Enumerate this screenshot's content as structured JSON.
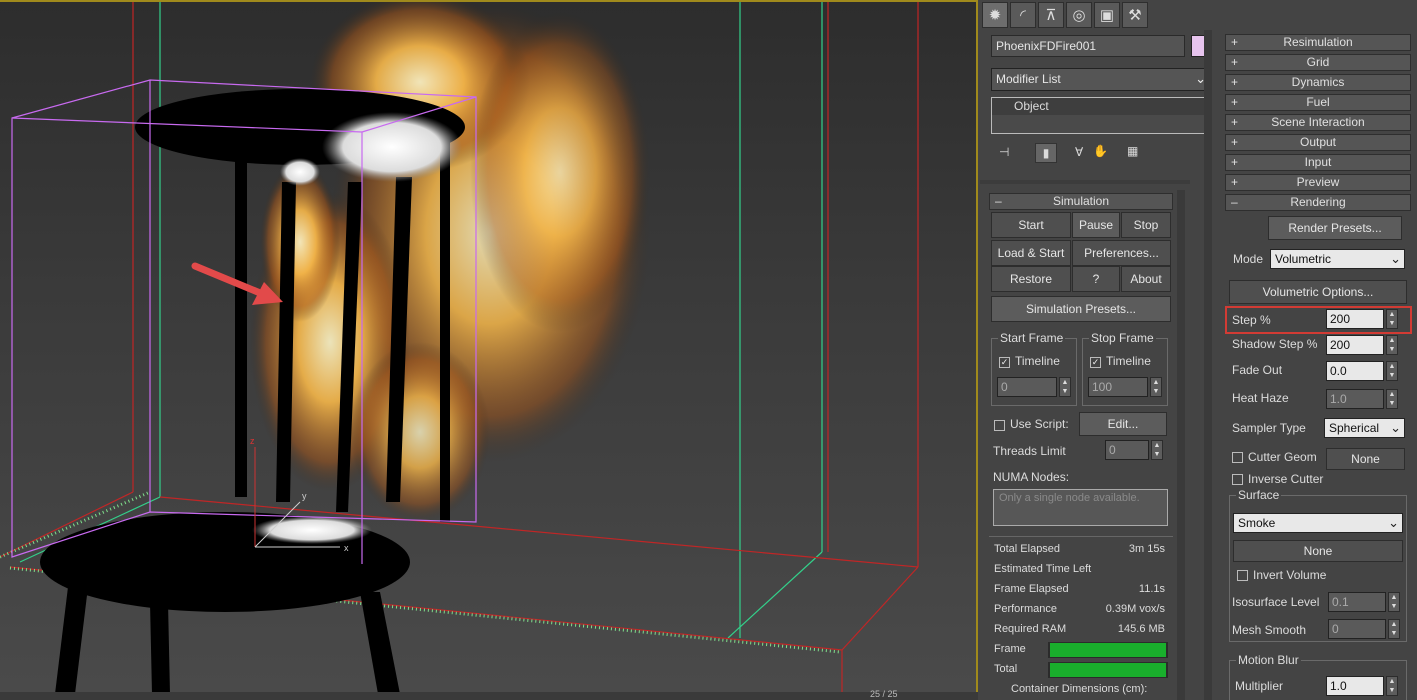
{
  "colors": {
    "accent_red": "#d23b34",
    "progress_green": "#19ae2c",
    "object_color": "#e7c4ee",
    "viewport_border": "#a08a1c"
  },
  "viewport": {
    "bottom_readout": "25 / 25",
    "axes": {
      "z": "z",
      "y": "y",
      "x": "x"
    }
  },
  "tabs": [
    {
      "name": "create-tab",
      "icon": "sun-icon"
    },
    {
      "name": "modify-tab",
      "icon": "modify-arc-icon"
    },
    {
      "name": "hierarchy-tab",
      "icon": "hierarchy-icon"
    },
    {
      "name": "motion-tab",
      "icon": "motion-icon"
    },
    {
      "name": "display-tab",
      "icon": "display-icon"
    },
    {
      "name": "utilities-tab",
      "icon": "hammer-icon"
    }
  ],
  "object": {
    "name": "PhoenixFDFire001"
  },
  "modifier": {
    "list_label": "Modifier List",
    "stack_item": "Object"
  },
  "simulation": {
    "header": "Simulation",
    "start": "Start",
    "pause": "Pause",
    "stop": "Stop",
    "load_start": "Load & Start",
    "preferences": "Preferences...",
    "restore": "Restore",
    "help": "?",
    "about": "About",
    "presets": "Simulation Presets...",
    "start_frame": {
      "label": "Start Frame",
      "timeline": "Timeline",
      "value": "0"
    },
    "stop_frame": {
      "label": "Stop Frame",
      "timeline": "Timeline",
      "value": "100"
    },
    "use_script": "Use Script:",
    "edit": "Edit...",
    "threads_label": "Threads Limit",
    "threads_value": "0",
    "numa_label": "NUMA Nodes:",
    "numa_placeholder": "Only a single node available."
  },
  "stats": {
    "total_elapsed": {
      "label": "Total Elapsed",
      "value": "3m 15s"
    },
    "estimated_left": {
      "label": "Estimated Time Left",
      "value": ""
    },
    "frame_elapsed": {
      "label": "Frame Elapsed",
      "value": "11.1s"
    },
    "performance": {
      "label": "Performance",
      "value": "0.39M vox/s"
    },
    "ram": {
      "label": "Required RAM",
      "value": "145.6 MB"
    },
    "frame_label": "Frame",
    "frame_progress": 1.0,
    "total_label": "Total",
    "total_progress": 1.0,
    "container_label": "Container Dimensions (cm):"
  },
  "rollouts": {
    "resimulation": "Resimulation",
    "grid": "Grid",
    "dynamics": "Dynamics",
    "fuel": "Fuel",
    "scene_interaction": "Scene Interaction",
    "output": "Output",
    "input": "Input",
    "preview": "Preview",
    "rendering": "Rendering"
  },
  "rendering": {
    "render_presets": "Render Presets...",
    "mode_label": "Mode",
    "mode_value": "Volumetric",
    "vol_options": "Volumetric Options...",
    "step_label": "Step %",
    "step_value": "200",
    "shadow_step_label": "Shadow Step %",
    "shadow_step_value": "200",
    "fade_out_label": "Fade Out",
    "fade_out_value": "0.0",
    "heat_haze_label": "Heat Haze",
    "heat_haze_value": "1.0",
    "sampler_label": "Sampler Type",
    "sampler_value": "Spherical",
    "cutter_geom": "Cutter Geom",
    "cutter_none": "None",
    "inverse_cutter": "Inverse Cutter",
    "surface_label": "Surface",
    "surface_value": "Smoke",
    "surface_none": "None",
    "invert_volume": "Invert Volume",
    "iso_label": "Isosurface Level",
    "iso_value": "0.1",
    "mesh_smooth_label": "Mesh Smooth",
    "mesh_smooth_value": "0",
    "motion_blur_label": "Motion Blur",
    "multiplier_label": "Multiplier",
    "multiplier_value": "1.0"
  }
}
